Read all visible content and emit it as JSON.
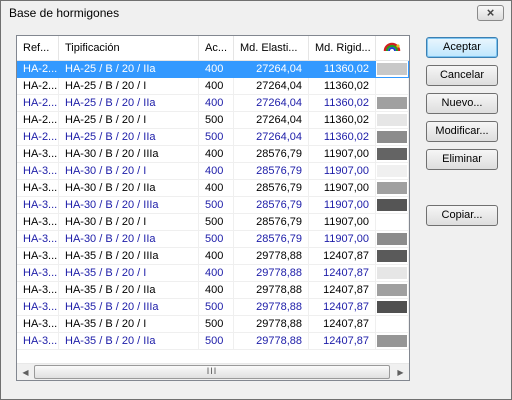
{
  "window": {
    "title": "Base de hormigones",
    "close_symbol": "×"
  },
  "table": {
    "columns": [
      {
        "label": "Ref..."
      },
      {
        "label": "Tipificación"
      },
      {
        "label": "Ac..."
      },
      {
        "label": "Md. Elasti..."
      },
      {
        "label": "Md. Rigid..."
      }
    ],
    "color_column_icon": "color-palette-icon",
    "rows": [
      {
        "ref": "HA-2...",
        "tip": "HA-25 / B / 20 / IIa",
        "ac": "400",
        "elast": "27264,04",
        "rigid": "11360,02",
        "color": "#c8c8c8",
        "style": "selected"
      },
      {
        "ref": "HA-2...",
        "tip": "HA-25 / B / 20 / I",
        "ac": "400",
        "elast": "27264,04",
        "rigid": "11360,02",
        "color": "#ffffff",
        "style": "black"
      },
      {
        "ref": "HA-2...",
        "tip": "HA-25 / B / 20 / IIa",
        "ac": "400",
        "elast": "27264,04",
        "rigid": "11360,02",
        "color": "#a0a0a0",
        "style": "blue"
      },
      {
        "ref": "HA-2...",
        "tip": "HA-25 / B / 20 / I",
        "ac": "500",
        "elast": "27264,04",
        "rigid": "11360,02",
        "color": "#e6e6e6",
        "style": "black"
      },
      {
        "ref": "HA-2...",
        "tip": "HA-25 / B / 20 / IIa",
        "ac": "500",
        "elast": "27264,04",
        "rigid": "11360,02",
        "color": "#8c8c8c",
        "style": "blue"
      },
      {
        "ref": "HA-3...",
        "tip": "HA-30 / B / 20 / IIIa",
        "ac": "400",
        "elast": "28576,79",
        "rigid": "11907,00",
        "color": "#646464",
        "style": "black"
      },
      {
        "ref": "HA-3...",
        "tip": "HA-30 / B / 20 / I",
        "ac": "400",
        "elast": "28576,79",
        "rigid": "11907,00",
        "color": "#f0f0f0",
        "style": "blue"
      },
      {
        "ref": "HA-3...",
        "tip": "HA-30 / B / 20 / IIa",
        "ac": "400",
        "elast": "28576,79",
        "rigid": "11907,00",
        "color": "#a0a0a0",
        "style": "black"
      },
      {
        "ref": "HA-3...",
        "tip": "HA-30 / B / 20 / IIIa",
        "ac": "500",
        "elast": "28576,79",
        "rigid": "11907,00",
        "color": "#555555",
        "style": "blue"
      },
      {
        "ref": "HA-3...",
        "tip": "HA-30 / B / 20 / I",
        "ac": "500",
        "elast": "28576,79",
        "rigid": "11907,00",
        "color": "#ffffff",
        "style": "black"
      },
      {
        "ref": "HA-3...",
        "tip": "HA-30 / B / 20 / IIa",
        "ac": "500",
        "elast": "28576,79",
        "rigid": "11907,00",
        "color": "#8c8c8c",
        "style": "blue"
      },
      {
        "ref": "HA-3...",
        "tip": "HA-35 / B / 20 / IIIa",
        "ac": "400",
        "elast": "29778,88",
        "rigid": "12407,87",
        "color": "#5a5a5a",
        "style": "black"
      },
      {
        "ref": "HA-3...",
        "tip": "HA-35 / B / 20 / I",
        "ac": "400",
        "elast": "29778,88",
        "rigid": "12407,87",
        "color": "#e6e6e6",
        "style": "blue"
      },
      {
        "ref": "HA-3...",
        "tip": "HA-35 / B / 20 / IIa",
        "ac": "400",
        "elast": "29778,88",
        "rigid": "12407,87",
        "color": "#a0a0a0",
        "style": "black"
      },
      {
        "ref": "HA-3...",
        "tip": "HA-35 / B / 20 / IIIa",
        "ac": "500",
        "elast": "29778,88",
        "rigid": "12407,87",
        "color": "#505050",
        "style": "blue"
      },
      {
        "ref": "HA-3...",
        "tip": "HA-35 / B / 20 / I",
        "ac": "500",
        "elast": "29778,88",
        "rigid": "12407,87",
        "color": "#ffffff",
        "style": "black"
      },
      {
        "ref": "HA-3...",
        "tip": "HA-35 / B / 20 / IIa",
        "ac": "500",
        "elast": "29778,88",
        "rigid": "12407,87",
        "color": "#969696",
        "style": "blue"
      }
    ]
  },
  "scrollbar": {
    "left_arrow": "◀",
    "right_arrow": "▶",
    "grip": "III"
  },
  "buttons": {
    "accept": "Aceptar",
    "cancel": "Cancelar",
    "new": "Nuevo...",
    "modify": "Modificar...",
    "delete": "Eliminar",
    "copy": "Copiar..."
  },
  "colors": {
    "selection": "#3399ff",
    "blue_text": "#1c1ca8"
  }
}
